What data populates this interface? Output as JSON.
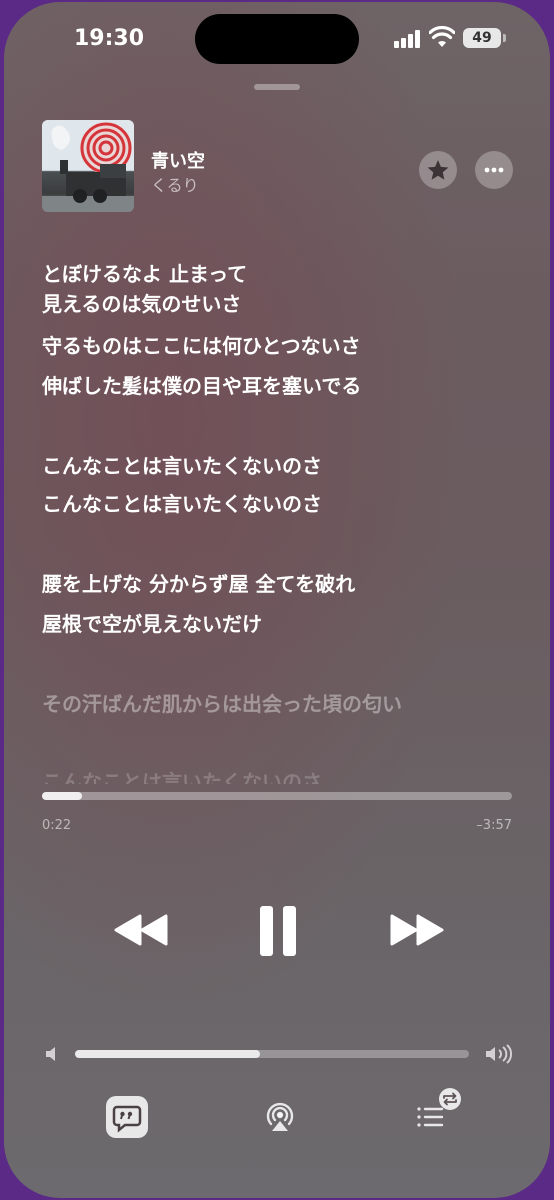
{
  "status": {
    "time": "19:30",
    "battery": "49"
  },
  "track": {
    "title": "青い空",
    "artist": "くるり"
  },
  "lyrics": [
    "とぼけるなよ 止まって",
    "見えるのは気のせいさ",
    "守るものはここには何ひとつないさ",
    "伸ばした髪は僕の目や耳を塞いでる",
    "こんなことは言いたくないのさ",
    "こんなことは言いたくないのさ",
    "腰を上げな 分からず屋 全てを破れ",
    "屋根で空が見えないだけ",
    "その汗ばんだ肌からは出会った頃の匂い",
    "こんなことは言いたくないのさ"
  ],
  "playback": {
    "elapsed": "0:22",
    "remaining": "–3:57",
    "progress": 0.085,
    "volume": 0.47
  },
  "icons": {
    "favorite": "star-icon",
    "more": "ellipsis-icon",
    "rewind": "backward-icon",
    "pause": "pause-icon",
    "forward": "forward-icon",
    "lyrics": "quote-bubble-icon",
    "airplay": "airplay-icon",
    "queue": "list-icon"
  },
  "colors": {
    "background": "#6a5c5f",
    "accent": "#ffffff"
  }
}
